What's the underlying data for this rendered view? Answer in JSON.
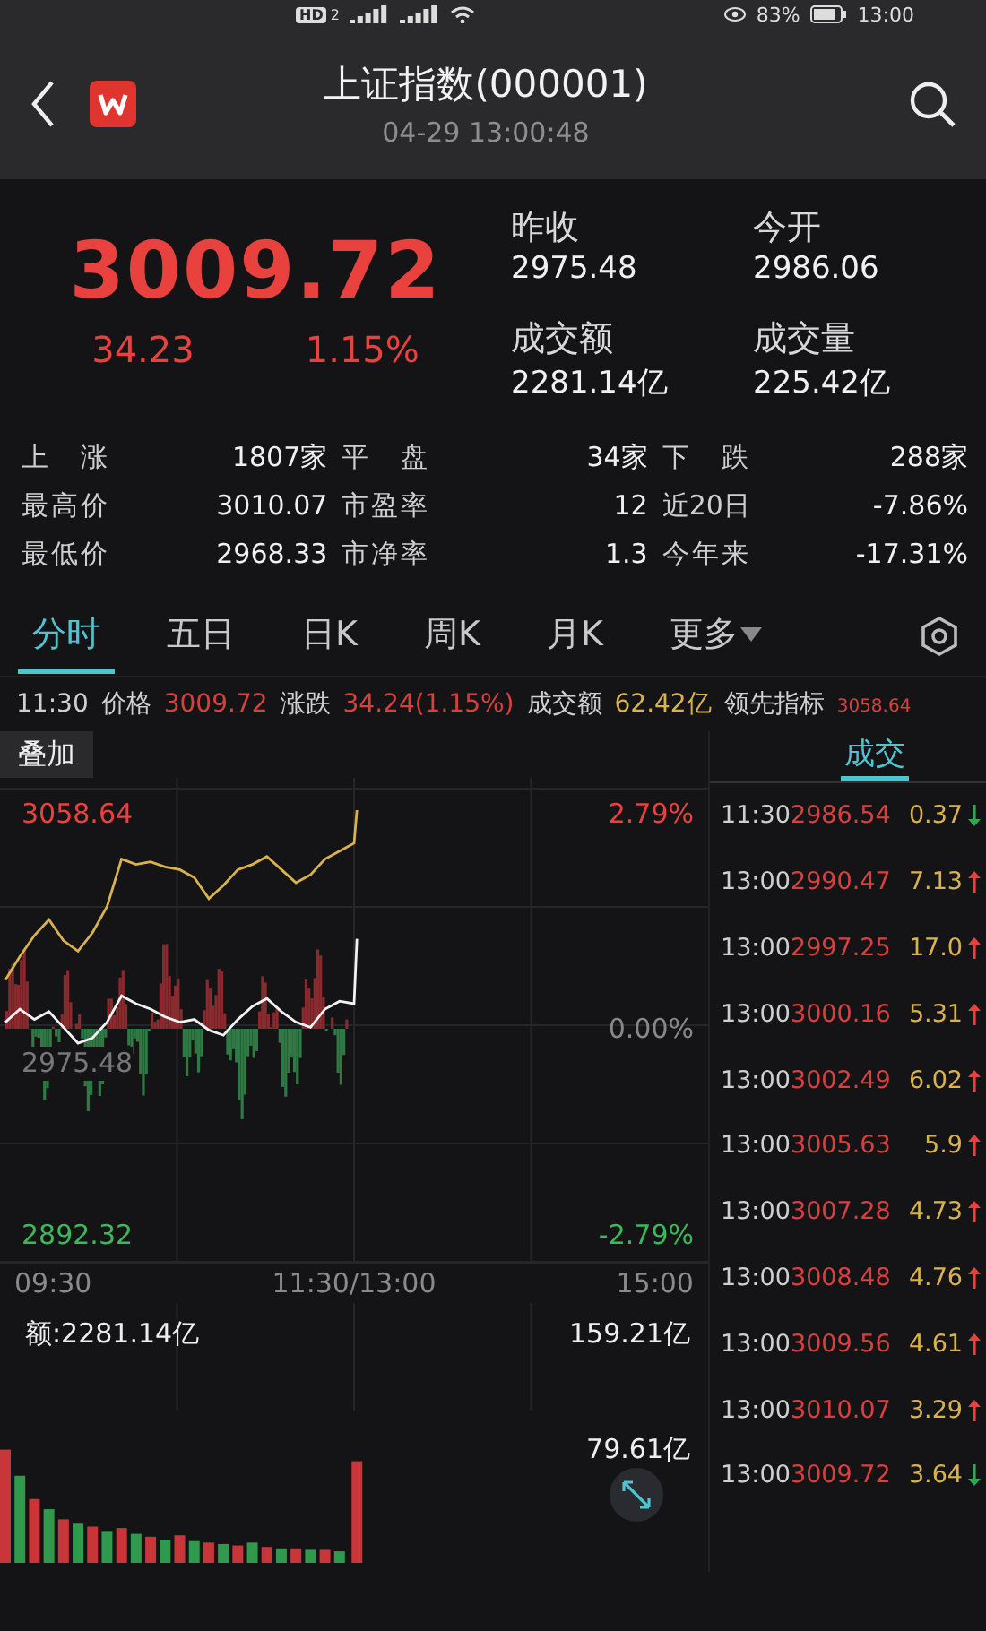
{
  "status_bar": {
    "hd": "HD",
    "sim": "2",
    "battery": "83%",
    "time": "13:00"
  },
  "header": {
    "title": "上证指数(000001)",
    "datetime": "04-29 13:00:48"
  },
  "quote": {
    "price": "3009.72",
    "change": "34.23",
    "change_pct": "1.15%",
    "rising": true,
    "fields": [
      {
        "label": "昨收",
        "value": "2975.48"
      },
      {
        "label": "今开",
        "value": "2986.06"
      },
      {
        "label": "成交额",
        "value": "2281.14亿"
      },
      {
        "label": "成交量",
        "value": "225.42亿"
      }
    ]
  },
  "stats": [
    [
      {
        "label": "上 涨",
        "value": "1807家"
      },
      {
        "label": "平 盘",
        "value": "34家"
      },
      {
        "label": "下 跌",
        "value": "288家"
      }
    ],
    [
      {
        "label": "最高价",
        "value": "3010.07"
      },
      {
        "label": "市盈率",
        "value": "12"
      },
      {
        "label": "近20日",
        "value": "-7.86%"
      }
    ],
    [
      {
        "label": "最低价",
        "value": "2968.33"
      },
      {
        "label": "市净率",
        "value": "1.3"
      },
      {
        "label": "今年来",
        "value": "-17.31%"
      }
    ]
  ],
  "tabs": [
    {
      "label": "分时",
      "selected": true
    },
    {
      "label": "五日",
      "selected": false
    },
    {
      "label": "日K",
      "selected": false
    },
    {
      "label": "周K",
      "selected": false
    },
    {
      "label": "月K",
      "selected": false
    },
    {
      "label": "更多",
      "selected": false,
      "dropdown": true
    }
  ],
  "info_line": [
    {
      "text": "11:30",
      "kind": "time"
    },
    {
      "text": "价格",
      "kind": "label"
    },
    {
      "text": "3009.72",
      "kind": "up"
    },
    {
      "text": "涨跌",
      "kind": "label"
    },
    {
      "text": "34.24(1.15%)",
      "kind": "up"
    },
    {
      "text": "成交额",
      "kind": "label"
    },
    {
      "text": "62.42亿",
      "kind": "amount"
    },
    {
      "text": "领先指标",
      "kind": "label"
    },
    {
      "text": "3058.64",
      "kind": "small"
    }
  ],
  "overlay_button": "叠加",
  "side_tab": {
    "label": "成交",
    "selected": true
  },
  "price_chart": {
    "center_label": "2975.48",
    "percent_labels": [
      "2.79%",
      "0.00%",
      "-2.79%"
    ],
    "time_axis": [
      "09:30",
      "11:30/13:00",
      "15:00"
    ],
    "high_label": "3058.64",
    "low_label": "2892.32"
  },
  "volume_chart": {
    "total": "额:2281.14亿",
    "top_label": "159.21亿",
    "mid_label": "79.61亿"
  },
  "trades": [
    {
      "time": "11:30",
      "price": "2986.54",
      "volume": "0.37",
      "up": false
    },
    {
      "time": "13:00",
      "price": "2990.47",
      "volume": "7.13",
      "up": true
    },
    {
      "time": "13:00",
      "price": "2997.25",
      "volume": "17.0",
      "up": true
    },
    {
      "time": "13:00",
      "price": "3000.16",
      "volume": "5.31",
      "up": true
    },
    {
      "time": "13:00",
      "price": "3002.49",
      "volume": "6.02",
      "up": true
    },
    {
      "time": "13:00",
      "price": "3005.63",
      "volume": "5.9",
      "up": true
    },
    {
      "time": "13:00",
      "price": "3007.28",
      "volume": "4.73",
      "up": true
    },
    {
      "time": "13:00",
      "price": "3008.48",
      "volume": "4.76",
      "up": true
    },
    {
      "time": "13:00",
      "price": "3009.56",
      "volume": "4.61",
      "up": true
    },
    {
      "time": "13:00",
      "price": "3010.07",
      "volume": "3.29",
      "up": true
    },
    {
      "time": "13:00",
      "price": "3009.72",
      "volume": "3.64",
      "up": false
    }
  ]
}
